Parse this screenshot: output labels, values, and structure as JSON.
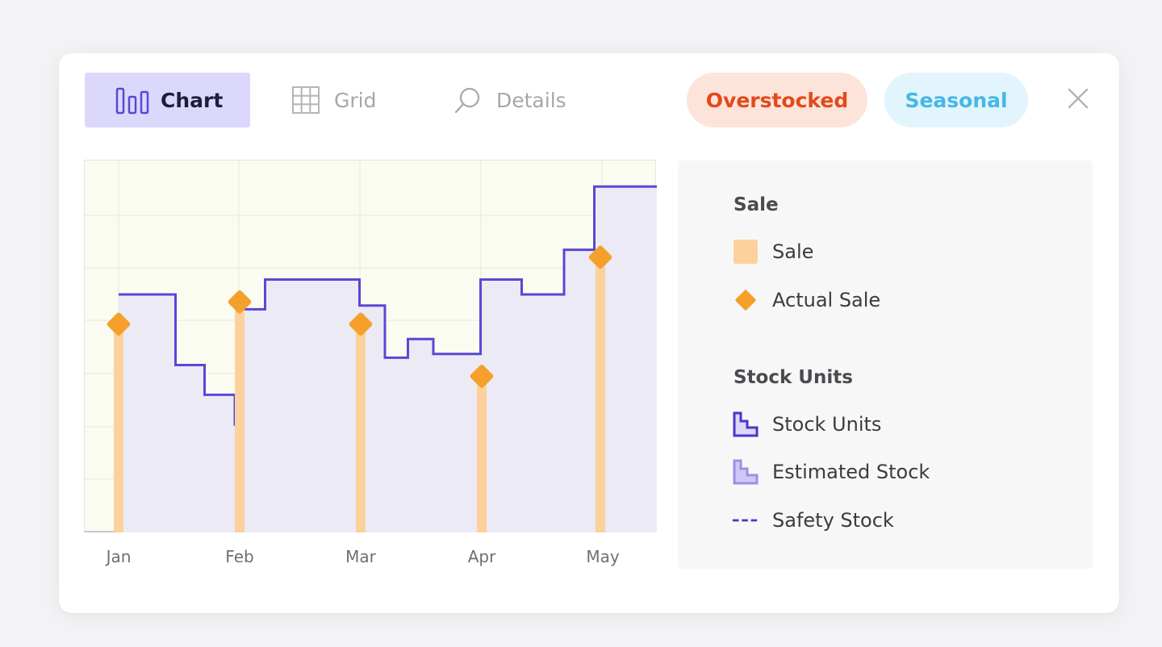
{
  "toolbar": {
    "tabs": [
      {
        "label": "Chart",
        "icon": "bar-chart-icon",
        "active": true
      },
      {
        "label": "Grid",
        "icon": "grid-icon",
        "active": false
      },
      {
        "label": "Details",
        "icon": "search-icon",
        "active": false
      }
    ],
    "badges": [
      {
        "label": "Overstocked",
        "color": "#e3491c",
        "bg": "#fde4da"
      },
      {
        "label": "Seasonal",
        "color": "#45b8e6",
        "bg": "#e2f4fc"
      }
    ],
    "close_icon": "close-icon"
  },
  "chart_data": {
    "type": "line",
    "categories": [
      "Jan",
      "Feb",
      "Mar",
      "Apr",
      "May"
    ],
    "grid": true,
    "series": [
      {
        "name": "Stock Units",
        "kind": "step-area",
        "color": "#5a47d6",
        "x": [
          0,
          0.47,
          0.71,
          0.96,
          1.0,
          1.21,
          1.99,
          2.2,
          2.39,
          2.6,
          2.99,
          3.33,
          3.68,
          3.93
        ],
        "y": [
          64,
          45,
          37,
          29,
          60,
          68,
          61,
          47,
          52,
          48,
          68,
          64,
          76,
          93
        ]
      },
      {
        "name": "Actual Sale",
        "kind": "lollipop",
        "color": "#f5a02a",
        "stem_color": "#fdd19c",
        "x": [
          0,
          1,
          2,
          3,
          3.98
        ],
        "y": [
          56,
          62,
          56,
          42,
          74
        ]
      }
    ],
    "ylim": [
      0,
      100
    ],
    "legend": "right-panel"
  },
  "legend": {
    "groups": [
      {
        "title": "Sale",
        "items": [
          {
            "label": "Sale",
            "icon": "sale-swatch-icon"
          },
          {
            "label": "Actual Sale",
            "icon": "diamond-marker-icon"
          }
        ]
      },
      {
        "title": "Stock Units",
        "items": [
          {
            "label": "Stock Units",
            "icon": "step-area-icon"
          },
          {
            "label": "Estimated Stock",
            "icon": "step-area-light-icon"
          },
          {
            "label": "Safety Stock",
            "icon": "dashed-line-icon"
          }
        ]
      }
    ]
  }
}
